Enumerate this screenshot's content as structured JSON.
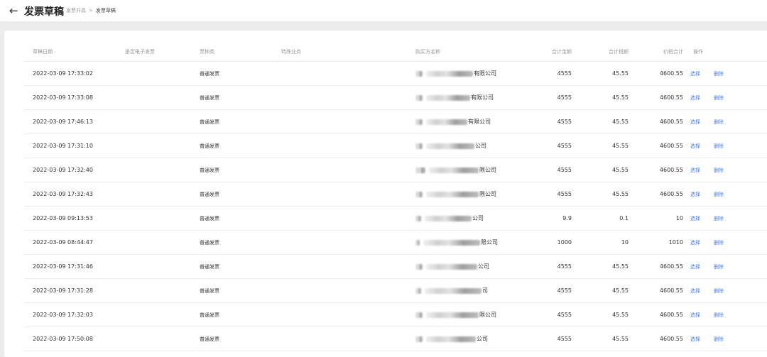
{
  "header": {
    "back_icon": "arrow-left-icon",
    "title": "发票草稿",
    "breadcrumb": [
      "发票开具",
      ">",
      "发票草稿"
    ]
  },
  "table": {
    "columns": [
      "草稿日期",
      "是否电子发票",
      "票种类",
      "特殊业务",
      "购买方名称",
      "合计金额",
      "合计税额",
      "价税合计",
      "操作"
    ],
    "rows": [
      {
        "date": "2022-03-09 17:33:02",
        "electronic": "",
        "type": "普通发票",
        "special": "",
        "buyer_suffix": "有限公司",
        "amount": "4555",
        "tax": "45.55",
        "total": "4600.55",
        "op_select": "选择",
        "op_delete": "删除"
      },
      {
        "date": "2022-03-09 17:33:08",
        "electronic": "",
        "type": "普通发票",
        "special": "",
        "buyer_suffix": "有限公司",
        "amount": "4555",
        "tax": "45.55",
        "total": "4600.55",
        "op_select": "选择",
        "op_delete": "删除"
      },
      {
        "date": "2022-03-09 17:46:13",
        "electronic": "",
        "type": "普通发票",
        "special": "",
        "buyer_suffix": "有限公司",
        "amount": "4555",
        "tax": "45.55",
        "total": "4600.55",
        "op_select": "选择",
        "op_delete": "删除"
      },
      {
        "date": "2022-03-09 17:31:10",
        "electronic": "",
        "type": "普通发票",
        "special": "",
        "buyer_suffix": "公司",
        "amount": "4555",
        "tax": "45.55",
        "total": "4600.55",
        "op_select": "选择",
        "op_delete": "删除"
      },
      {
        "date": "2022-03-09 17:32:40",
        "electronic": "",
        "type": "普通发票",
        "special": "",
        "buyer_suffix": "限公司",
        "amount": "4555",
        "tax": "45.55",
        "total": "4600.55",
        "op_select": "选择",
        "op_delete": "删除"
      },
      {
        "date": "2022-03-09 17:32:43",
        "electronic": "",
        "type": "普通发票",
        "special": "",
        "buyer_suffix": "限公司",
        "amount": "4555",
        "tax": "45.55",
        "total": "4600.55",
        "op_select": "选择",
        "op_delete": "删除"
      },
      {
        "date": "2022-03-09 09:13:53",
        "electronic": "",
        "type": "普通发票",
        "special": "",
        "buyer_suffix": "公司",
        "amount": "9.9",
        "tax": "0.1",
        "total": "10",
        "op_select": "选择",
        "op_delete": "删除"
      },
      {
        "date": "2022-03-09 08:44:47",
        "electronic": "",
        "type": "普通发票",
        "special": "",
        "buyer_suffix": "限公司",
        "amount": "1000",
        "tax": "10",
        "total": "1010",
        "op_select": "选择",
        "op_delete": "删除"
      },
      {
        "date": "2022-03-09 17:31:46",
        "electronic": "",
        "type": "普通发票",
        "special": "",
        "buyer_suffix": "公司",
        "amount": "4555",
        "tax": "45.55",
        "total": "4600.55",
        "op_select": "选择",
        "op_delete": "删除"
      },
      {
        "date": "2022-03-09 17:31:28",
        "electronic": "",
        "type": "普通发票",
        "special": "",
        "buyer_suffix": "司",
        "amount": "4555",
        "tax": "45.55",
        "total": "4600.55",
        "op_select": "选择",
        "op_delete": "删除"
      },
      {
        "date": "2022-03-09 17:32:03",
        "electronic": "",
        "type": "普通发票",
        "special": "",
        "buyer_suffix": "限公司",
        "amount": "4555",
        "tax": "45.55",
        "total": "4600.55",
        "op_select": "选择",
        "op_delete": "删除"
      },
      {
        "date": "2022-03-09 17:50:08",
        "electronic": "",
        "type": "普通发票",
        "special": "",
        "buyer_suffix": "公司",
        "amount": "4555",
        "tax": "45.55",
        "total": "4600.55",
        "op_select": "选择",
        "op_delete": "删除"
      }
    ]
  },
  "colors": {
    "link": "#4a7de0",
    "background": "#ececec",
    "panel": "#ffffff"
  }
}
